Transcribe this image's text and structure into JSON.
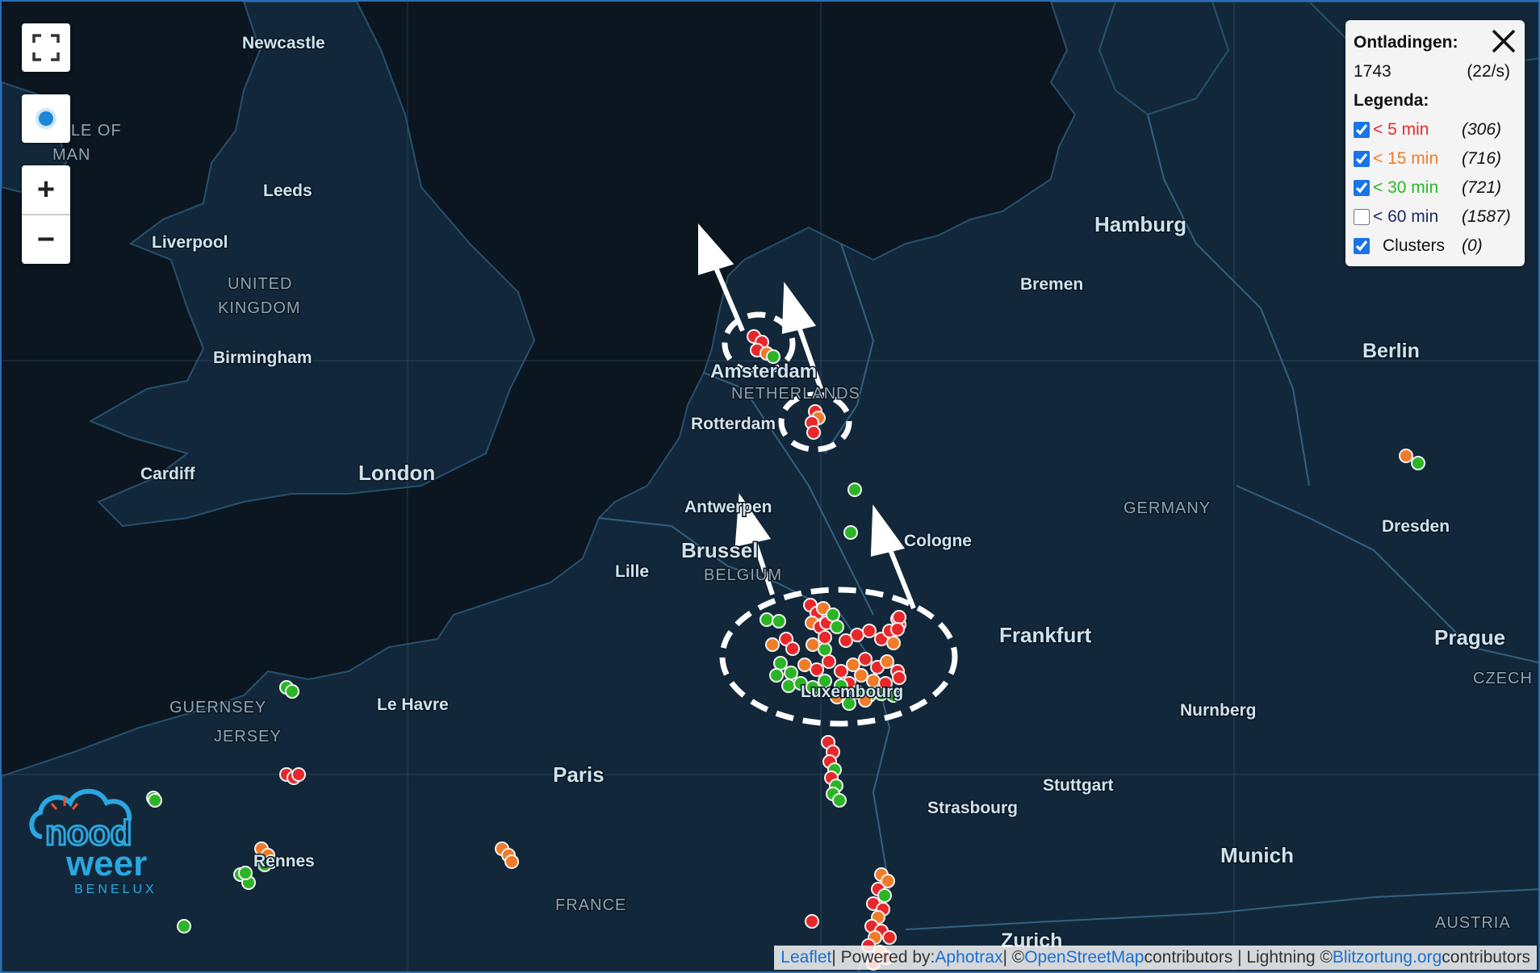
{
  "map": {
    "cities": [
      {
        "name": "Newcastle"
      },
      {
        "name": "Leeds"
      },
      {
        "name": "Liverpool"
      },
      {
        "name": "Birmingham"
      },
      {
        "name": "Cardiff"
      },
      {
        "name": "London"
      },
      {
        "name": "Le Havre"
      },
      {
        "name": "Paris"
      },
      {
        "name": "Rennes"
      },
      {
        "name": "Lille"
      },
      {
        "name": "Brussel"
      },
      {
        "name": "Antwerpen"
      },
      {
        "name": "Rotterdam"
      },
      {
        "name": "Amsterdam"
      },
      {
        "name": "Bremen"
      },
      {
        "name": "Hamburg"
      },
      {
        "name": "Berlin"
      },
      {
        "name": "Dresden"
      },
      {
        "name": "Prague"
      },
      {
        "name": "Frankfurt"
      },
      {
        "name": "Nurnberg"
      },
      {
        "name": "Stuttgart"
      },
      {
        "name": "Strasbourg"
      },
      {
        "name": "Munich"
      },
      {
        "name": "Zurich"
      },
      {
        "name": "Cologne"
      },
      {
        "name": "Luxembourg"
      }
    ],
    "countries": [
      {
        "name": "UNITED"
      },
      {
        "name": "KINGDOM"
      },
      {
        "name": "ISLE OF"
      },
      {
        "name": "MAN"
      },
      {
        "name": "GUERNSEY"
      },
      {
        "name": "JERSEY"
      },
      {
        "name": "FRANCE"
      },
      {
        "name": "BELGIUM"
      },
      {
        "name": "NETHERLANDS"
      },
      {
        "name": "GERMANY"
      },
      {
        "name": "CZECH"
      },
      {
        "name": "AUSTRIA"
      }
    ]
  },
  "controls": {
    "fullscreen_icon": "fullscreen-icon",
    "locate_icon": "location-dot-icon",
    "zoom_in": "+",
    "zoom_out": "−"
  },
  "legend": {
    "title": "Ontladingen:",
    "count": "1743",
    "rate": "(22/s)",
    "legend_title": "Legenda:",
    "items": [
      {
        "label": "< 5 min",
        "count": "(306)",
        "checked": true,
        "color": "#e8272b"
      },
      {
        "label": "< 15 min",
        "count": "(716)",
        "checked": true,
        "color": "#f07b28"
      },
      {
        "label": "< 30 min",
        "count": "(721)",
        "checked": true,
        "color": "#2bb526"
      },
      {
        "label": "< 60 min",
        "count": "(1587)",
        "checked": false,
        "color": "#1b2a6b"
      },
      {
        "label": "Clusters",
        "count": "(0)",
        "checked": true,
        "color": "#111111"
      }
    ]
  },
  "logo": {
    "line1": "nood",
    "line2": "weer",
    "line3": "BENELUX"
  },
  "attribution": {
    "leaflet": "Leaflet",
    "sep1": " | Powered by: ",
    "aphotrax": "Aphotrax",
    "sep2": " | © ",
    "osm": "OpenStreetMap",
    "sep3": " contributors | Lightning © ",
    "blitz": "Blitzortung.org",
    "sep4": " contributors"
  },
  "colors": {
    "strike_recent": "#e8272b",
    "strike_15": "#f07b28",
    "strike_30": "#2bb526",
    "land": "#12283a",
    "sea": "#0b1620",
    "border": "#3c6f93"
  }
}
